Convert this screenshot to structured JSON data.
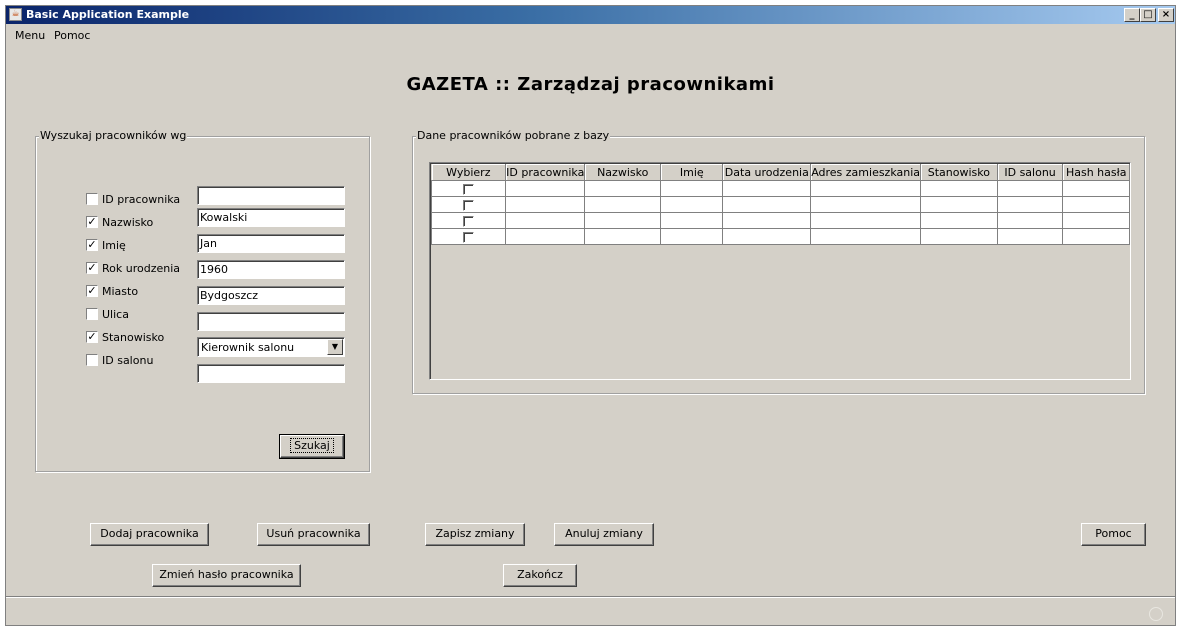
{
  "window": {
    "title": "Basic Application Example",
    "app_icon": "java-cup-icon",
    "controls": {
      "minimize": "_",
      "maximize": "□",
      "close": "×"
    }
  },
  "menu": [
    "Menu",
    "Pomoc"
  ],
  "page_title": "GAZETA :: Zarządzaj pracownikami",
  "search_panel": {
    "legend": "Wyszukaj pracowników wg",
    "filters": [
      {
        "label": "ID pracownika",
        "checked": false,
        "value": ""
      },
      {
        "label": "Nazwisko",
        "checked": true,
        "value": "Kowalski"
      },
      {
        "label": "Imię",
        "checked": true,
        "value": "Jan"
      },
      {
        "label": "Rok urodzenia",
        "checked": true,
        "value": "1960"
      },
      {
        "label": "Miasto",
        "checked": true,
        "value": "Bydgoszcz"
      },
      {
        "label": "Ulica",
        "checked": false,
        "value": ""
      },
      {
        "label": "Stanowisko",
        "checked": true,
        "value": "Kierownik salonu"
      },
      {
        "label": "ID salonu",
        "checked": false,
        "value": ""
      }
    ],
    "search_button": "Szukaj"
  },
  "results_panel": {
    "legend": "Dane pracowników pobrane z bazy",
    "columns": [
      "Wybierz",
      "ID pracownika",
      "Nazwisko",
      "Imię",
      "Data urodzenia",
      "Adres zamieszkania",
      "Stanowisko",
      "ID salonu",
      "Hash hasła"
    ],
    "rows": [
      [
        "",
        "",
        "",
        "",
        "",
        "",
        "",
        ""
      ],
      [
        "",
        "",
        "",
        "",
        "",
        "",
        "",
        ""
      ],
      [
        "",
        "",
        "",
        "",
        "",
        "",
        "",
        ""
      ],
      [
        "",
        "",
        "",
        "",
        "",
        "",
        "",
        ""
      ]
    ]
  },
  "actions": {
    "add": "Dodaj pracownika",
    "remove": "Usuń pracownika",
    "save": "Zapisz zmiany",
    "cancel": "Anuluj zmiany",
    "help": "Pomoc",
    "change_password": "Zmień hasło pracownika",
    "exit": "Zakończ"
  }
}
